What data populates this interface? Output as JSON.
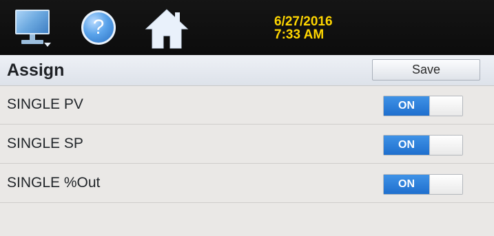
{
  "topbar": {
    "icons": [
      "monitor-icon",
      "help-icon",
      "home-icon"
    ],
    "help_glyph": "?",
    "date": "6/27/2016",
    "time": "7:33 AM",
    "date_color": "#ffd600"
  },
  "page": {
    "title": "Assign",
    "save_label": "Save"
  },
  "rows": [
    {
      "label": "SINGLE PV",
      "toggle": "ON"
    },
    {
      "label": "SINGLE SP",
      "toggle": "ON"
    },
    {
      "label": "SINGLE %Out",
      "toggle": "ON"
    }
  ],
  "colors": {
    "toggle_on": "#2a7ddb",
    "background": "#eae8e6"
  }
}
